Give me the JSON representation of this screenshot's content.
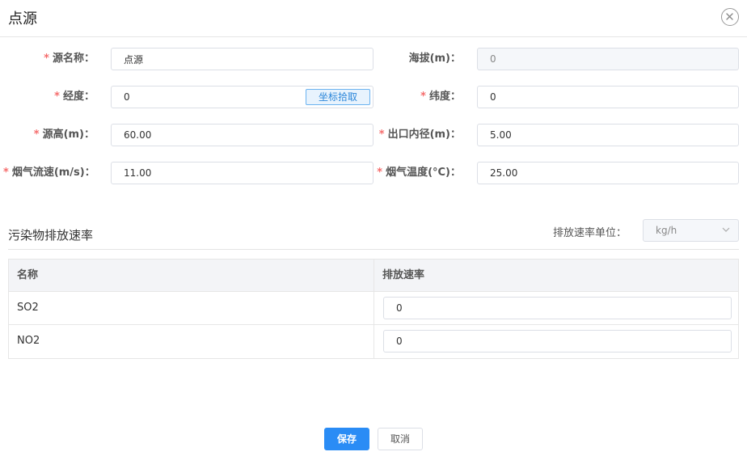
{
  "dialog": {
    "title": "点源",
    "close_icon": "close-circle-icon"
  },
  "form": {
    "name": {
      "label": "源名称：",
      "value": "点源",
      "required": true
    },
    "altitude": {
      "label": "海拔(m)：",
      "value": "0",
      "required": false,
      "disabled": true
    },
    "longitude": {
      "label": "经度：",
      "value": "0",
      "required": true,
      "pick_label": "坐标拾取"
    },
    "latitude": {
      "label": "纬度：",
      "value": "0",
      "required": true
    },
    "height": {
      "label": "源高(m)：",
      "value": "60.00",
      "required": true
    },
    "outlet_diameter": {
      "label": "出口内径(m)：",
      "value": "5.00",
      "required": true
    },
    "gas_velocity": {
      "label": "烟气流速(m/s)：",
      "value": "11.00",
      "required": true
    },
    "gas_temperature": {
      "label": "烟气温度(°C)：",
      "value": "25.00",
      "required": true
    }
  },
  "required_mark": "*",
  "pollutants": {
    "title": "污染物排放速率",
    "unit_label": "排放速率单位：",
    "unit_value": "kg/h",
    "columns": [
      "名称",
      "排放速率"
    ],
    "rows": [
      {
        "name": "SO2",
        "rate": "0"
      },
      {
        "name": "NO2",
        "rate": "0"
      }
    ]
  },
  "actions": {
    "save_label": "保存",
    "cancel_label": "取消"
  },
  "colors": {
    "primary": "#2a8cf5",
    "required": "#f56c6c",
    "pick_button": "#2b86d9"
  }
}
